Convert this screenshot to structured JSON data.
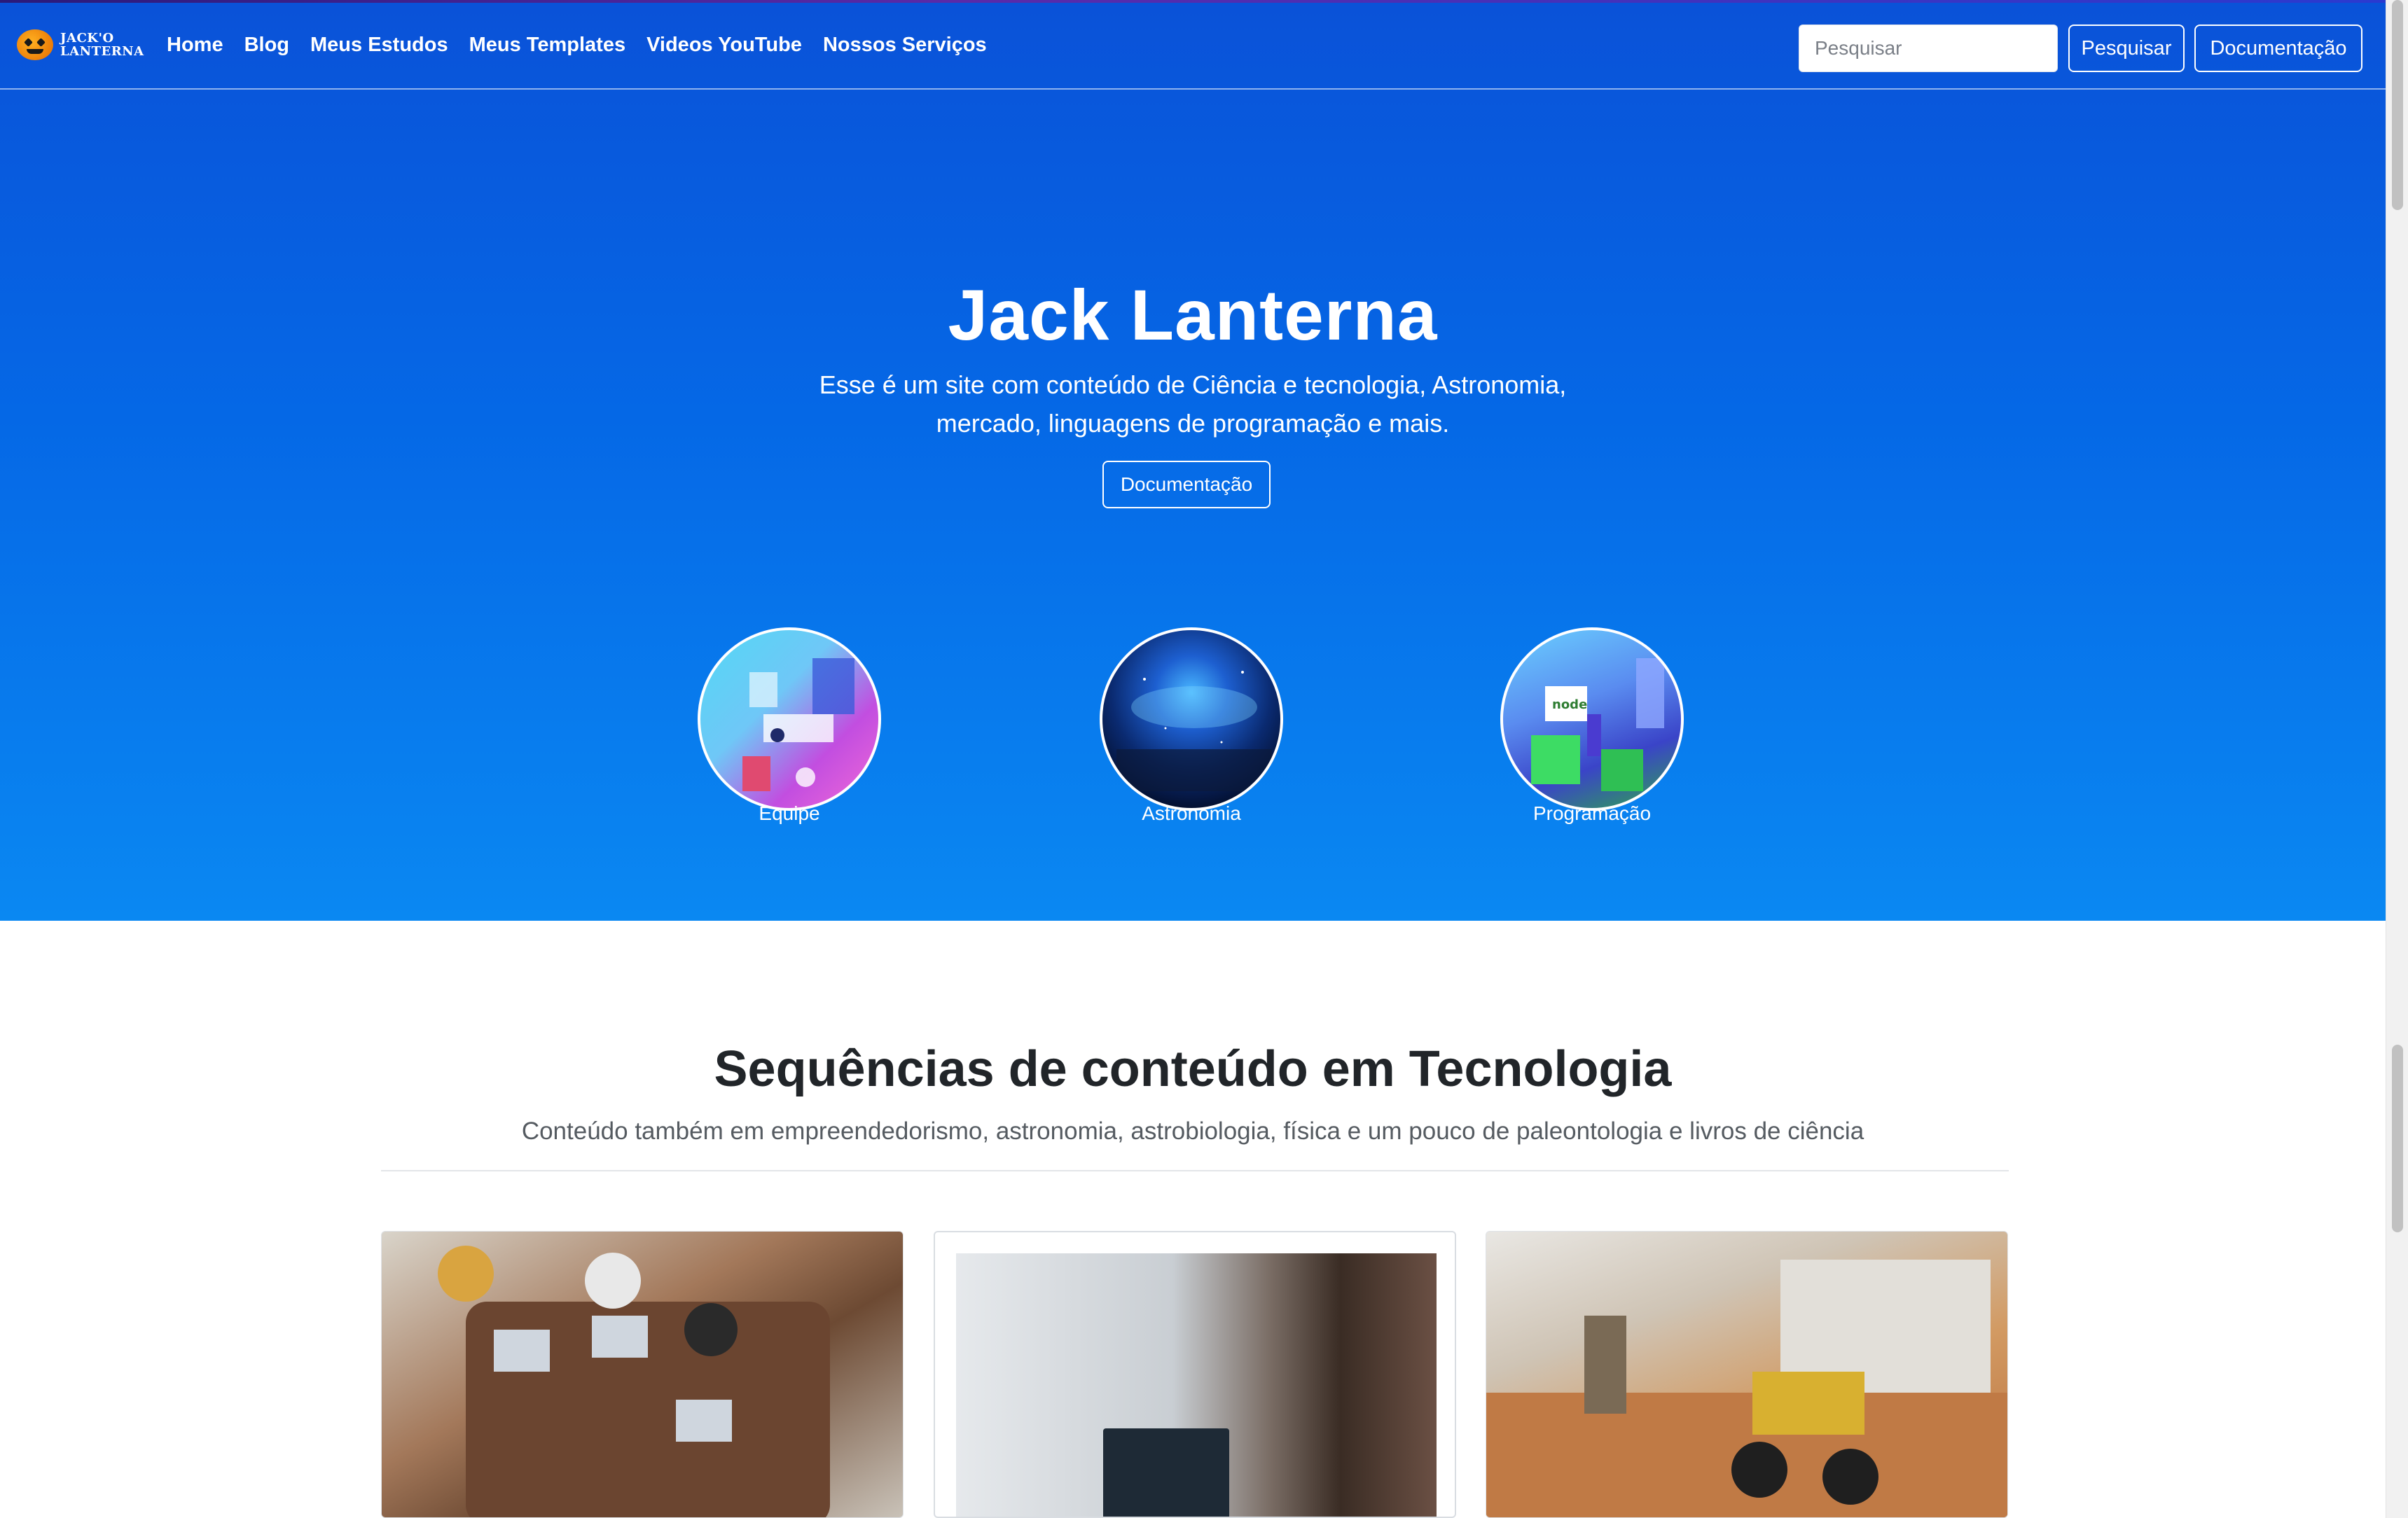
{
  "navbar": {
    "brand_line1": "JACK'O",
    "brand_line2": "LANTERNA",
    "links": [
      "Home",
      "Blog",
      "Meus Estudos",
      "Meus Templates",
      "Videos YouTube",
      "Nossos Serviços"
    ],
    "search_placeholder": "Pesquisar",
    "search_button": "Pesquisar",
    "doc_button": "Documentação"
  },
  "hero": {
    "title": "Jack Lanterna",
    "subtitle": "Esse é um site com conteúdo de Ciência e tecnologia, Astronomia, mercado, linguagens de programação e mais.",
    "button": "Documentação",
    "features": [
      {
        "label": "Equipe",
        "icon": "team-illustration"
      },
      {
        "label": "Astronomia",
        "icon": "space-illustration"
      },
      {
        "label": "Programação",
        "icon": "nodejs-illustration"
      }
    ]
  },
  "section": {
    "title": "Sequências de conteúdo em Tecnologia",
    "subtitle": "Conteúdo também em empreendedorismo, astronomia, astrobiologia, física e um pouco de paleontologia e livros de ciência"
  },
  "colors": {
    "hero_top": "#0a52d8",
    "hero_bottom": "#0a88f2"
  }
}
